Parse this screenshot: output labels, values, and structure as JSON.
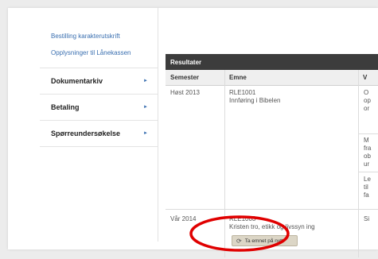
{
  "sidebar": {
    "links": [
      "Bestilling karakterutskrift",
      "Opplysninger til Lånekassen"
    ],
    "items": [
      {
        "label": "Dokumentarkiv",
        "arrow": "►"
      },
      {
        "label": "Betaling",
        "arrow": "►"
      },
      {
        "label": "Spørreundersøkelse",
        "arrow": "►"
      }
    ]
  },
  "results": {
    "title": "Resultater",
    "columns": [
      "Semester",
      "Emne",
      "V"
    ],
    "rows": [
      {
        "semester": "Høst 2013",
        "code": "RLE1001",
        "name": "Innføring i Bibelen",
        "v": [
          [
            "O",
            "op",
            "or"
          ],
          [
            "M",
            "fra",
            "ob",
            "ur"
          ],
          [
            "Le",
            "til",
            "fa"
          ]
        ]
      },
      {
        "semester": "Vår 2014",
        "code": "RLE1003",
        "name": "Kristen tro, etikk og livssyn ing",
        "v": [
          [
            "Si"
          ]
        ]
      }
    ],
    "retake_button": "Ta emnet på nytt",
    "retake_icon": "refresh-icon"
  },
  "colors": {
    "link": "#3a6fb0",
    "header": "#3c3c3c",
    "highlight": "#e00000"
  }
}
